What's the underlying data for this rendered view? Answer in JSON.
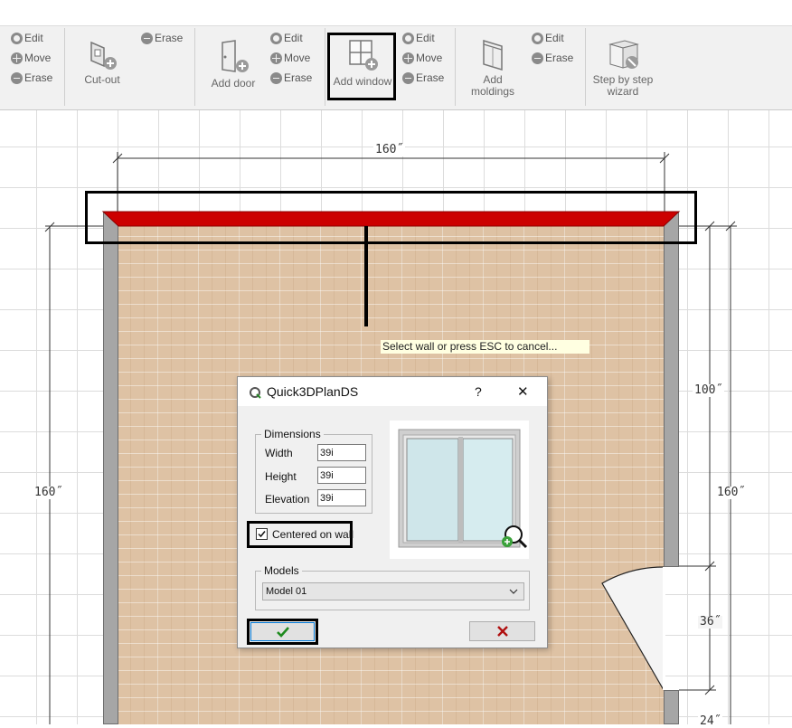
{
  "toolbar": {
    "group_window_tools": {
      "edit": "Edit",
      "move": "Move",
      "erase": "Erase"
    },
    "cutout": {
      "label": "Cut-out",
      "erase": "Erase"
    },
    "door": {
      "label": "Add door",
      "edit": "Edit",
      "move": "Move",
      "erase": "Erase"
    },
    "window": {
      "label": "Add window",
      "edit": "Edit",
      "move": "Move",
      "erase": "Erase"
    },
    "moldings": {
      "label_line1": "Add",
      "label_line2": "moldings",
      "edit": "Edit",
      "erase": "Erase"
    },
    "wizard": {
      "label_line1": "Step by step",
      "label_line2": "wizard"
    }
  },
  "plan": {
    "dimension_top": "160˝",
    "dimension_left": "160˝",
    "dimension_right_upper": "100˝",
    "dimension_right_mid": "160˝",
    "dimension_door": "36˝",
    "dimension_bottom_right": "24˝",
    "wall_highlight_color": "#cc0000",
    "tooltip": "Select wall or press ESC to cancel..."
  },
  "dialog": {
    "title": "Quick3DPlanDS",
    "help": "?",
    "close": "✕",
    "dimensions_group": "Dimensions",
    "width_label": "Width",
    "width_value": "39i",
    "height_label": "Height",
    "height_value": "39i",
    "elevation_label": "Elevation",
    "elevation_value": "39i",
    "centered_label": "Centered on wall",
    "centered_checked": true,
    "models_group": "Models",
    "model_selected": "Model 01",
    "ok_color": "#1d8a1d",
    "cancel_color": "#b01010"
  }
}
